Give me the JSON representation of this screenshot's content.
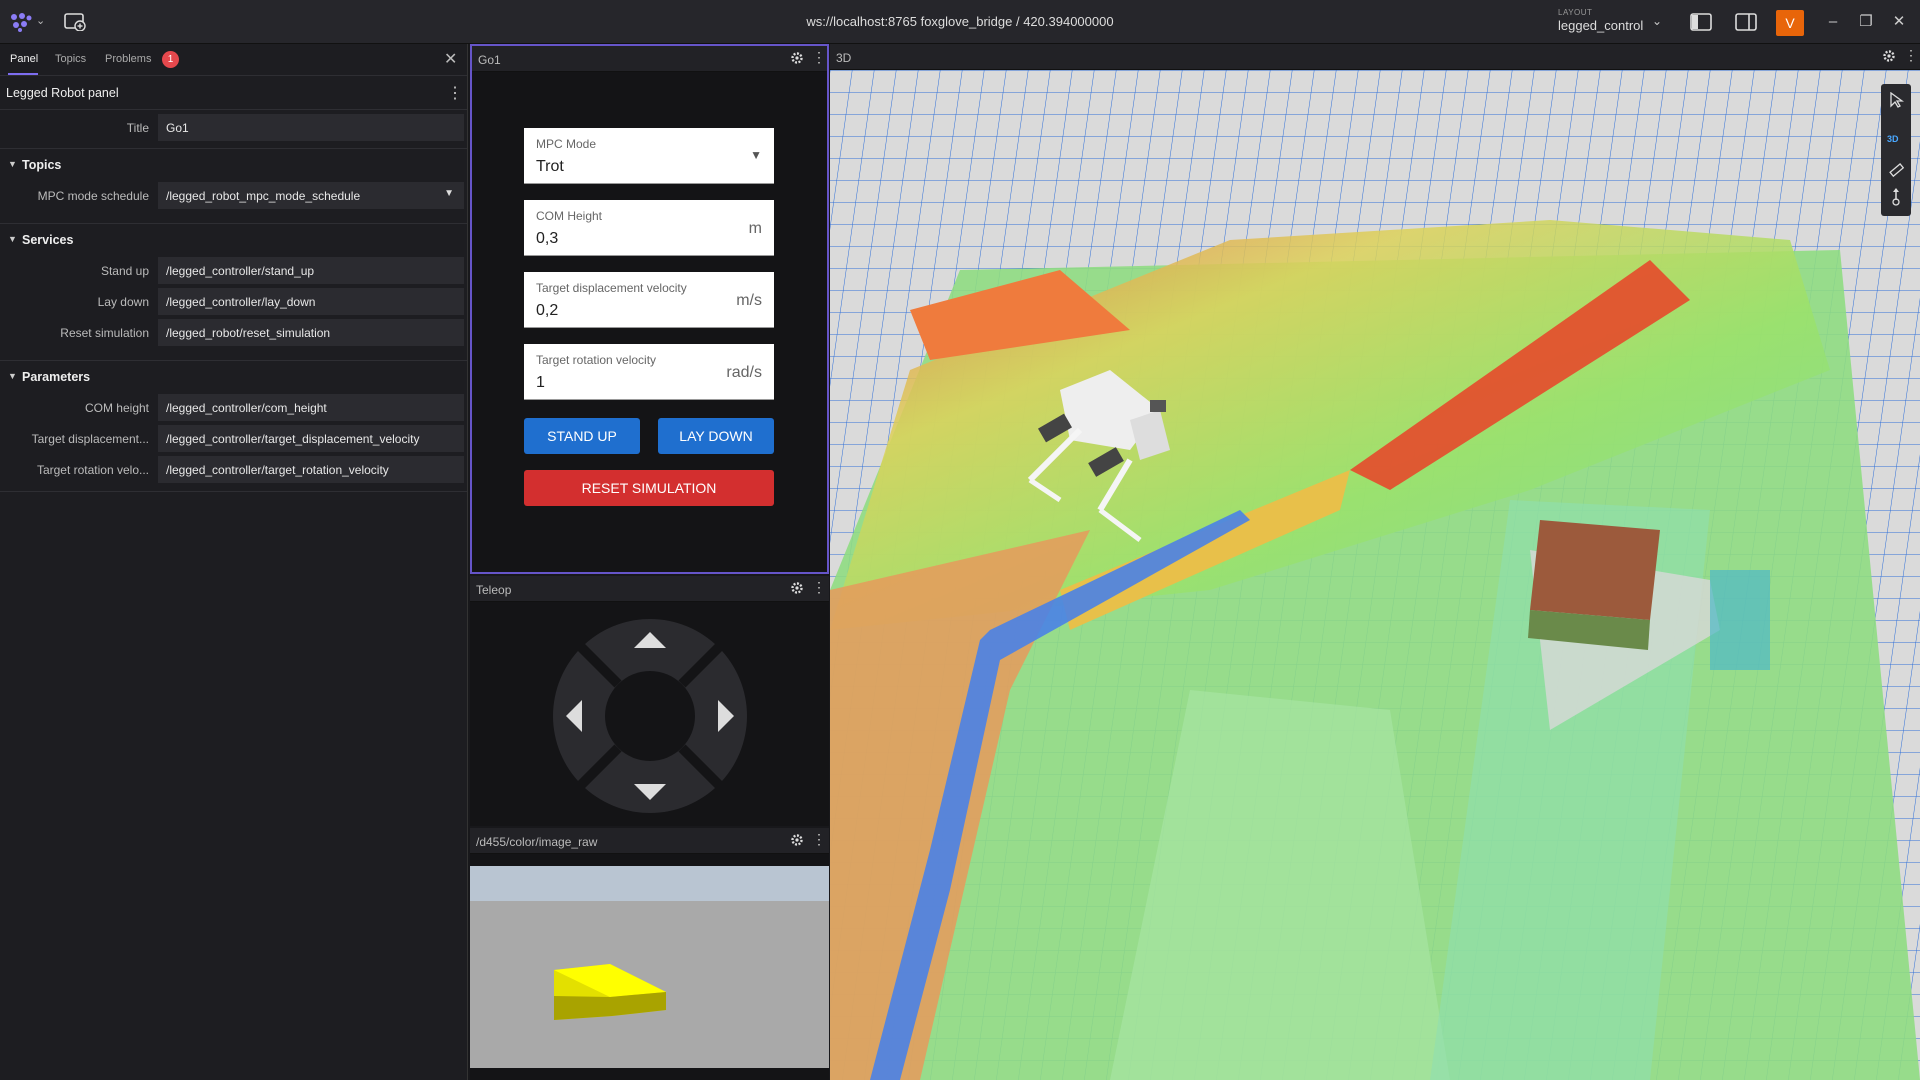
{
  "topbar": {
    "connection": "ws://localhost:8765 foxglove_bridge / 420.394000000",
    "layout_caption": "LAYOUT",
    "layout_name": "legged_control",
    "avatar_initial": "V",
    "accent": "#e8650a"
  },
  "sidebar": {
    "tabs": [
      {
        "label": "Panel",
        "active": true
      },
      {
        "label": "Topics",
        "active": false
      },
      {
        "label": "Problems",
        "active": false
      }
    ],
    "problems_count": "1",
    "panel_title": "Legged Robot panel",
    "title_field": {
      "label": "Title",
      "value": "Go1"
    },
    "sections": {
      "topics": {
        "label": "Topics",
        "fields": [
          {
            "label": "MPC mode schedule",
            "value": "/legged_robot_mpc_mode_schedule"
          }
        ]
      },
      "services": {
        "label": "Services",
        "fields": [
          {
            "label": "Stand up",
            "value": "/legged_controller/stand_up"
          },
          {
            "label": "Lay down",
            "value": "/legged_controller/lay_down"
          },
          {
            "label": "Reset simulation",
            "value": "/legged_robot/reset_simulation"
          }
        ]
      },
      "parameters": {
        "label": "Parameters",
        "fields": [
          {
            "label": "COM height",
            "value": "/legged_controller/com_height"
          },
          {
            "label": "Target displacement...",
            "value": "/legged_controller/target_displacement_velocity"
          },
          {
            "label": "Target rotation velo...",
            "value": "/legged_controller/target_rotation_velocity"
          }
        ]
      }
    }
  },
  "go1_panel": {
    "title": "Go1",
    "mpc_mode": {
      "label": "MPC Mode",
      "value": "Trot"
    },
    "com_height": {
      "label": "COM Height",
      "value": "0,3",
      "unit": "m"
    },
    "target_disp": {
      "label": "Target displacement velocity",
      "value": "0,2",
      "unit": "m/s"
    },
    "target_rot": {
      "label": "Target rotation velocity",
      "value": "1",
      "unit": "rad/s"
    },
    "stand_up": "STAND UP",
    "lay_down": "LAY DOWN",
    "reset": "RESET SIMULATION"
  },
  "teleop_panel": {
    "title": "Teleop"
  },
  "camera_panel": {
    "title": "/d455/color/image_raw"
  },
  "view3d": {
    "title": "3D",
    "mode_label": "3D"
  }
}
